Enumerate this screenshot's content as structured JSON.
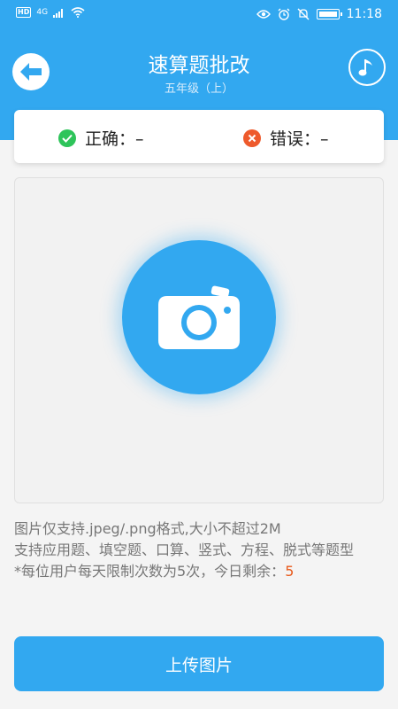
{
  "status_bar": {
    "left_badge": "HD",
    "network": "4G",
    "time": "11:18"
  },
  "header": {
    "title": "速算题批改",
    "subtitle": "五年级（上）",
    "back_icon": "arrow-left-icon",
    "music_icon": "music-note-icon"
  },
  "score": {
    "correct_label": "正确：",
    "correct_value": "–",
    "wrong_label": "错误：",
    "wrong_value": "–"
  },
  "notes": {
    "line1": "图片仅支持.jpeg/.png格式,大小不超过2M",
    "line2": "支持应用题、填空题、口算、竖式、方程、脱式等题型",
    "line3_prefix": "*每位用户每天限制次数为5次，今日剩余：",
    "remaining": "5"
  },
  "upload_button": "上传图片",
  "colors": {
    "primary": "#32a8f0",
    "correct": "#2ec45a",
    "wrong": "#ee5a2c",
    "remaining": "#e85a1c"
  }
}
